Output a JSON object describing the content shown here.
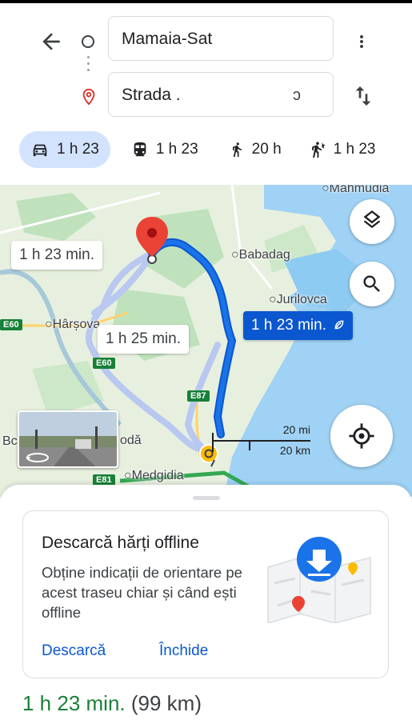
{
  "directions": {
    "origin": "Mamaia-Sat",
    "destination": "Strada .",
    "destination_tail": " ɔ"
  },
  "modes": [
    {
      "name": "car",
      "label": "1 h 23",
      "active": true
    },
    {
      "name": "transit",
      "label": "1 h 23",
      "active": false
    },
    {
      "name": "walk",
      "label": "20 h",
      "active": false
    },
    {
      "name": "rideshare",
      "label": "1 h 23",
      "active": false
    }
  ],
  "map": {
    "places": {
      "mahmudia": "Mahmudia",
      "babadag": "Babadag",
      "jurilovca": "Jurilovca",
      "harsova": "Hârșova",
      "medgidia": "Medgidia",
      "bc": "Bc",
      "oda": "odă"
    },
    "routes": {
      "alt1": "1 h 23 min.",
      "alt2": "1 h 25 min.",
      "main": "1 h 23 min."
    },
    "roads": {
      "e60a": "E60",
      "e60b": "E60",
      "e87": "E87",
      "e81": "E81"
    },
    "scale": {
      "imperial": "20 mi",
      "metric": "20 km"
    },
    "colors": {
      "route": "#1a5cf5",
      "route_alt": "#b8c8f0",
      "water": "#9fd2f5",
      "land": "#e7f0df",
      "park": "#bfe2bd"
    }
  },
  "offline_card": {
    "title": "Descarcă hărți offline",
    "body": "Obține indicații de orientare pe acest traseu chiar și când ești offline",
    "download": "Descarcă",
    "close": "Închide"
  },
  "summary": {
    "time": "1 h 23 min.",
    "distance": "(99 km)"
  }
}
